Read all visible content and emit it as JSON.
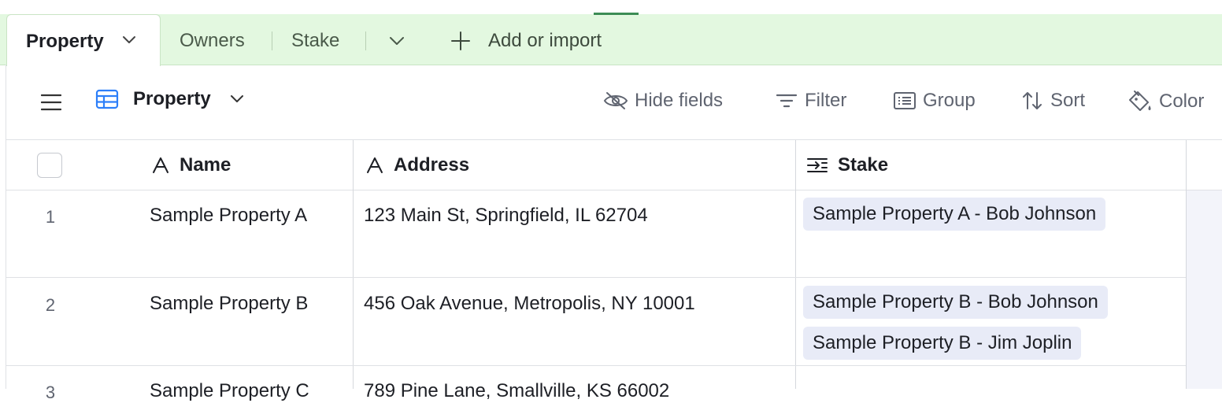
{
  "tabs": {
    "active": "Property",
    "others": [
      "Owners",
      "Stake"
    ],
    "add_import": "Add or import"
  },
  "toolbar": {
    "view_name": "Property",
    "hide_fields": "Hide fields",
    "filter": "Filter",
    "group": "Group",
    "sort": "Sort",
    "color": "Color"
  },
  "table": {
    "columns": [
      "Name",
      "Address",
      "Stake"
    ],
    "rows": [
      {
        "num": "1",
        "name": "Sample Property A",
        "address": "123 Main St, Springfield, IL 62704",
        "stakes": [
          "Sample Property A - Bob Johnson"
        ]
      },
      {
        "num": "2",
        "name": "Sample Property B",
        "address": "456 Oak Avenue, Metropolis, NY 10001",
        "stakes": [
          "Sample Property B - Bob Johnson",
          "Sample Property B - Jim Joplin"
        ]
      },
      {
        "num": "3",
        "name": "Sample Property C",
        "address": "789 Pine Lane, Smallville, KS 66002",
        "stakes": []
      }
    ]
  },
  "colors": {
    "tabbar_bg": "#e3f8e0",
    "accent_green": "#3c8c55",
    "view_icon_blue": "#2d7ff9",
    "chip_bg": "#e8ebf7"
  },
  "icons": [
    "chevron-down-icon",
    "plus-icon",
    "hamburger-icon",
    "grid-view-icon",
    "eye-slash-icon",
    "filter-icon",
    "group-icon",
    "sort-icon",
    "paint-bucket-icon",
    "text-field-icon",
    "linked-record-icon"
  ]
}
